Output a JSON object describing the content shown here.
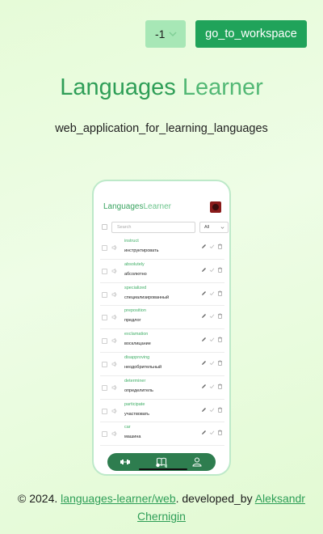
{
  "header": {
    "lang_select_value": "-1",
    "workspace_button_label": "go_to_workspace"
  },
  "hero": {
    "title_part1": "Languages",
    "title_part2": "Learner",
    "subtitle": "web_application_for_learning_languages"
  },
  "phone": {
    "app_title_part1": "Languages",
    "app_title_part2": "Learner",
    "search_placeholder": "Search",
    "filter_value": "All",
    "words": [
      {
        "word": "instruct",
        "translation": "инструктировать"
      },
      {
        "word": "absolutely",
        "translation": "абсолютно"
      },
      {
        "word": "specialized",
        "translation": "специализированный"
      },
      {
        "word": "preposition",
        "translation": "предлог"
      },
      {
        "word": "exclamation",
        "translation": "восклицание"
      },
      {
        "word": "disapproving",
        "translation": "неодобрительный"
      },
      {
        "word": "determiner",
        "translation": "определитель"
      },
      {
        "word": "participate",
        "translation": "участвовать"
      },
      {
        "word": "car",
        "translation": "машина"
      }
    ],
    "nav": [
      "dumbbell-icon",
      "book-icon",
      "user-icon"
    ]
  },
  "footer": {
    "copyright": "© 2024.",
    "repo_link": "languages-learner/web",
    "developed_by": ". developed_by",
    "author_link": "Aleksandr Chernigin"
  },
  "colors": {
    "accent": "#20a35a",
    "title": "#2e9e57",
    "select_bg": "#a7e7b6",
    "nav_bg": "#2e7d4f"
  }
}
